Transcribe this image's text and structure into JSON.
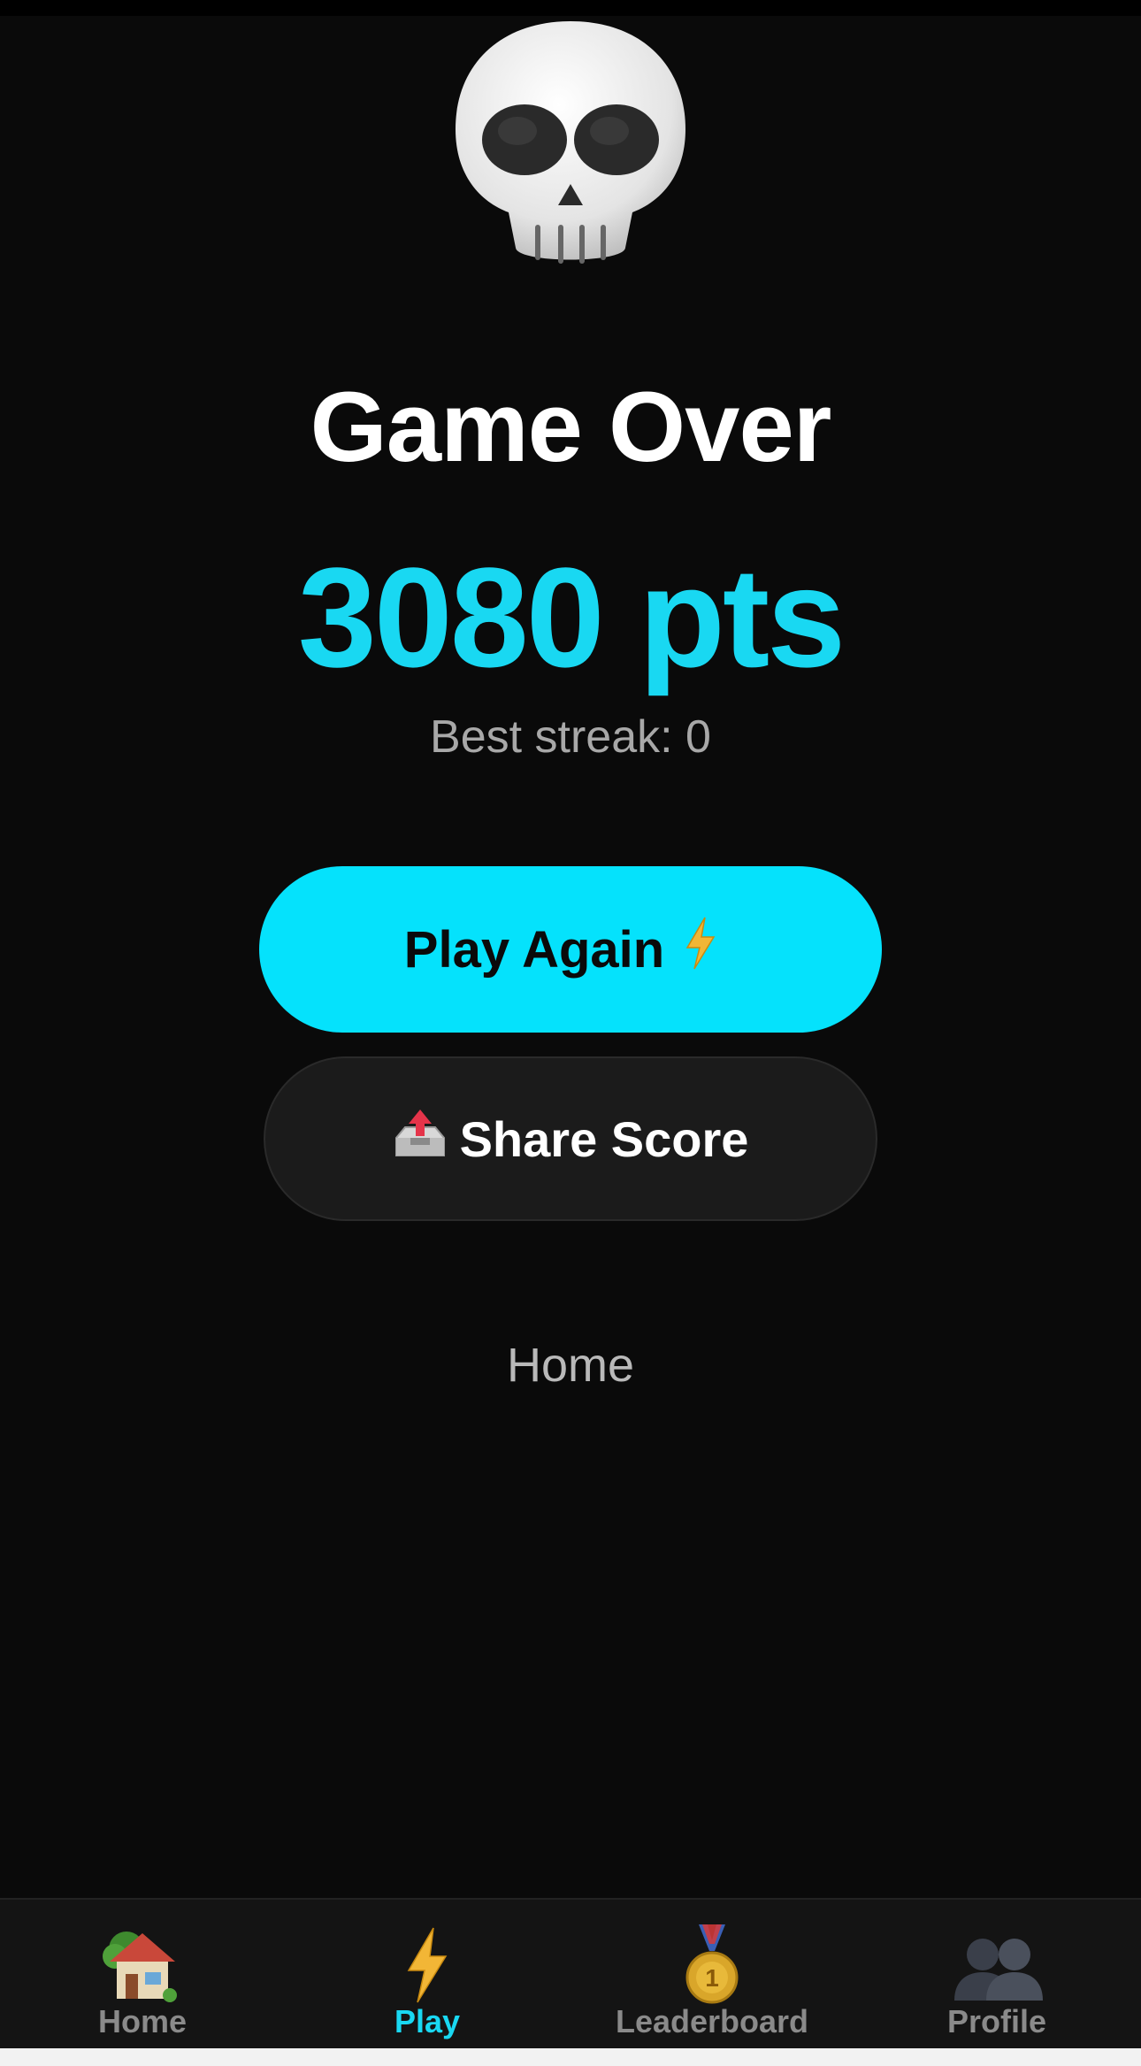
{
  "screen": {
    "title": "Game Over",
    "score_text": "3080 pts",
    "streak_text": "Best streak: 0",
    "play_again_label": "Play Again",
    "share_label": "Share Score",
    "home_link_label": "Home"
  },
  "icons": {
    "hero": "skull-icon",
    "play_again": "lightning-icon",
    "share": "outbox-tray-icon"
  },
  "tabbar": {
    "items": [
      {
        "label": "Home",
        "icon": "house-icon",
        "active": false
      },
      {
        "label": "Play",
        "icon": "lightning-icon",
        "active": true
      },
      {
        "label": "Leaderboard",
        "icon": "medal-icon",
        "active": false
      },
      {
        "label": "Profile",
        "icon": "people-icon",
        "active": false
      }
    ]
  },
  "colors": {
    "background": "#0a0a0a",
    "accent": "#05e2fc",
    "score": "#19d8f2",
    "secondary_button": "#1b1b1b",
    "tabbar": "#141414",
    "muted_text": "#a8a8a8"
  }
}
